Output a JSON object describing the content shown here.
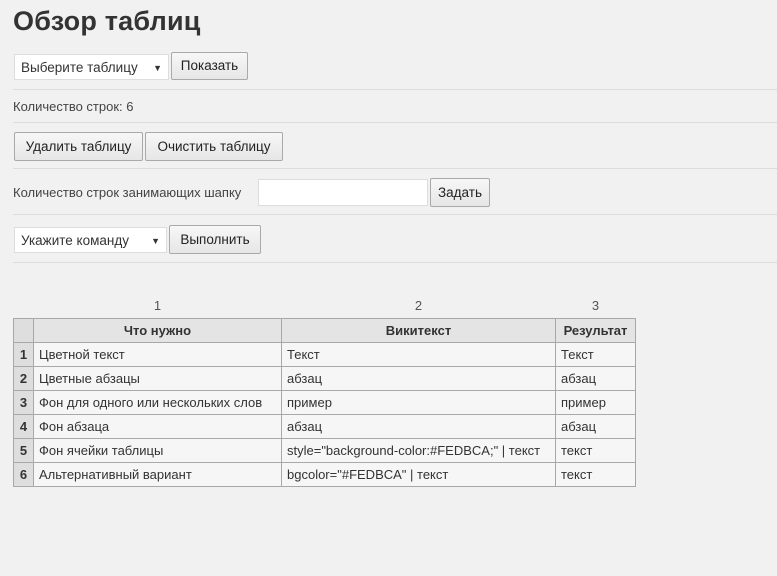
{
  "page": {
    "title": "Обзор таблиц"
  },
  "table_select": {
    "value": "Выберите таблицу",
    "show_button": "Показать"
  },
  "row_count_text": "Количество строк: 6",
  "actions": {
    "delete": "Удалить таблицу",
    "clear": "Очистить таблицу"
  },
  "header_rows": {
    "label": "Количество строк занимающих шапку",
    "input_value": "",
    "set_button": "Задать"
  },
  "command_select": {
    "value": "Укажите команду",
    "run_button": "Выполнить"
  },
  "preview_table": {
    "column_numbers": [
      "1",
      "2",
      "3"
    ],
    "headers": [
      "Что нужно",
      "Викитекст",
      "Результат"
    ],
    "rows": [
      {
        "n": "1",
        "cells": [
          "Цветной текст",
          "Текст",
          "Текст"
        ]
      },
      {
        "n": "2",
        "cells": [
          "Цветные абзацы",
          "абзац",
          "абзац"
        ]
      },
      {
        "n": "3",
        "cells": [
          "Фон для одного или нескольких слов",
          "пример",
          "пример"
        ]
      },
      {
        "n": "4",
        "cells": [
          "Фон абзаца",
          "абзац",
          "абзац"
        ]
      },
      {
        "n": "5",
        "cells": [
          "Фон ячейки таблицы",
          "style=\"background-color:#FEDBCA;\" | текст",
          "текст"
        ]
      },
      {
        "n": "6",
        "cells": [
          "Альтернативный вариант",
          "bgcolor=\"#FEDBCA\" | текст",
          "текст"
        ]
      }
    ]
  }
}
